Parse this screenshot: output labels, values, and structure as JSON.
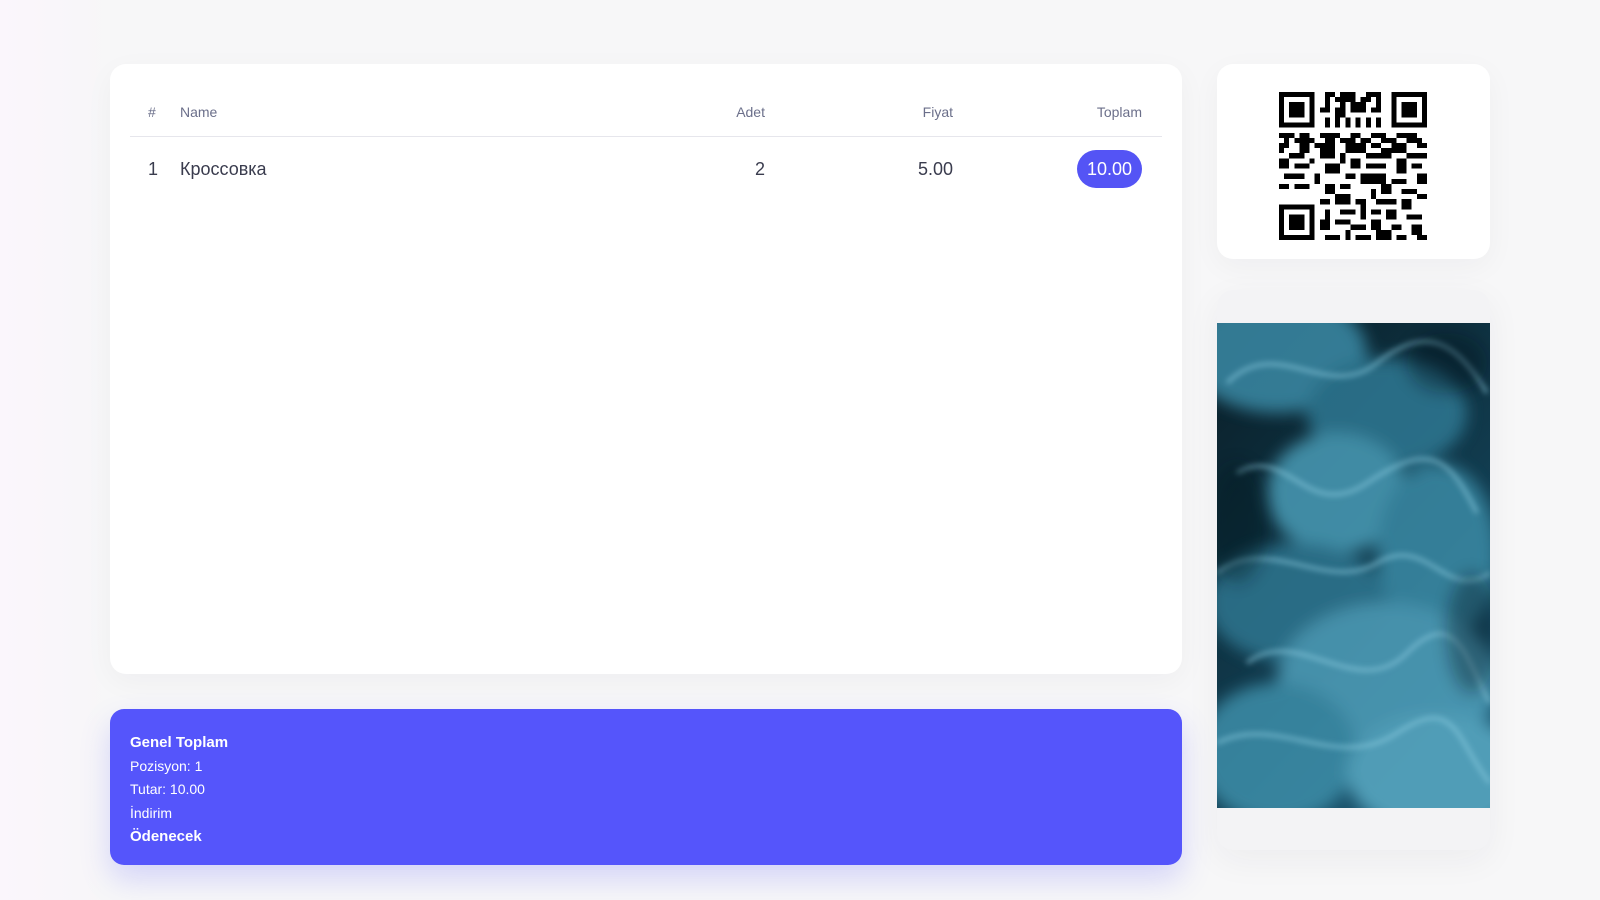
{
  "table": {
    "headers": {
      "num": "#",
      "name": "Name",
      "adet": "Adet",
      "fiyat": "Fiyat",
      "toplam": "Toplam"
    },
    "rows": [
      {
        "num": "1",
        "name": "Кроссовка",
        "adet": "2",
        "fiyat": "5.00",
        "toplam": "10.00"
      }
    ]
  },
  "summary": {
    "title": "Genel Toplam",
    "pozisyon": "Pozisyon: 1",
    "tutar": "Tutar: 10.00",
    "indirim": "İndirim",
    "odenecek": "Ödenecek"
  },
  "colors": {
    "accent": "#5555fb",
    "badge": "#5454f5",
    "card": "#ffffff",
    "background": "#f7f7f8"
  },
  "media": {
    "qr_icon": "qr-code-icon",
    "image": "blue-smoke-image"
  }
}
